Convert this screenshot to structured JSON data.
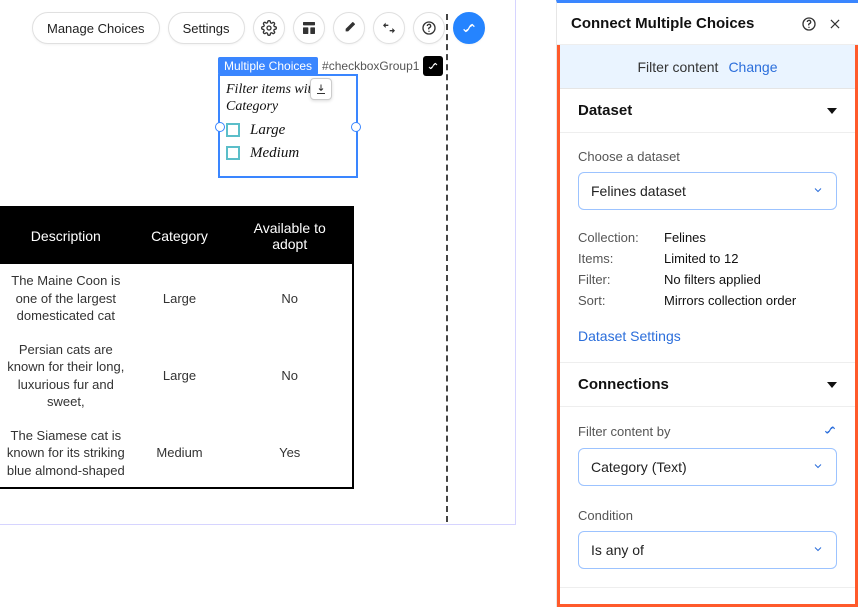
{
  "toolbar": {
    "manage_choices": "Manage Choices",
    "settings": "Settings"
  },
  "canvas": {
    "selected_tag": "Multiple Choices",
    "selected_id": "#checkboxGroup1",
    "filter_title": "Filter items with Category",
    "options": [
      "Large",
      "Medium"
    ]
  },
  "table": {
    "headers": [
      "Description",
      "Category",
      "Available to adopt"
    ],
    "rows": [
      {
        "desc": "The Maine Coon is one of the largest domesticated cat",
        "cat": "Large",
        "avail": "No"
      },
      {
        "desc": "Persian cats are known for their long, luxurious fur and sweet,",
        "cat": "Large",
        "avail": "No"
      },
      {
        "desc": "The Siamese cat is known for its striking blue almond-shaped",
        "cat": "Medium",
        "avail": "Yes"
      }
    ]
  },
  "panel": {
    "title": "Connect Multiple Choices",
    "filter_banner_label": "Filter content",
    "filter_banner_action": "Change",
    "dataset_heading": "Dataset",
    "choose_dataset_label": "Choose a dataset",
    "dataset_value": "Felines dataset",
    "collection_k": "Collection:",
    "collection_v": "Felines",
    "items_k": "Items:",
    "items_v": "Limited to 12",
    "filter_k": "Filter:",
    "filter_v": "No filters applied",
    "sort_k": "Sort:",
    "sort_v": "Mirrors collection order",
    "dataset_settings": "Dataset Settings",
    "connections_heading": "Connections",
    "filter_by_label": "Filter content by",
    "filter_by_value": "Category (Text)",
    "condition_label": "Condition",
    "condition_value": "Is any of"
  }
}
